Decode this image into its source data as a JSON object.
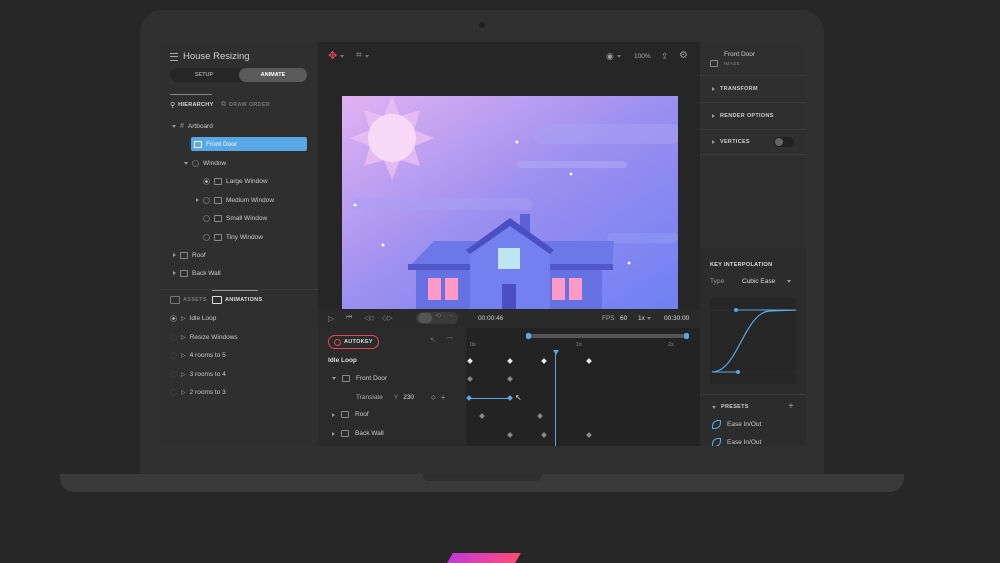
{
  "project": {
    "title": "House Resizing"
  },
  "modes": {
    "setup": "SETUP",
    "animate": "ANIMATE"
  },
  "hierarchy_tabs": {
    "hierarchy": "HIERARCHY",
    "draw_order": "DRAW ORDER"
  },
  "tree": {
    "artboard": "Artboard",
    "front_door": "Front Door",
    "window": "Window",
    "large_window": "Large Window",
    "medium_window": "Medium Window",
    "small_window": "Small Window",
    "tiny_window": "Tiny Window",
    "roof": "Roof",
    "back_wall": "Back Wall"
  },
  "bottom_tabs": {
    "assets": "ASSETS",
    "animations": "ANIMATIONS"
  },
  "animations": [
    "Idle Loop",
    "Resize Windows",
    "4 rooms to 5",
    "3 rooms to 4",
    "2 rooms to 3"
  ],
  "toolbar": {
    "zoom": "100%"
  },
  "playback": {
    "current_time": "00:00:46",
    "fps_label": "FPS",
    "fps": "60",
    "speed": "1x",
    "end_time": "00:30:00"
  },
  "timeline": {
    "autokey": "AUTOKEY",
    "animation_name": "Idle Loop",
    "ticks": [
      "0s",
      "1s",
      "2s"
    ],
    "tracks": {
      "front_door": "Front Door",
      "translate": "Translate",
      "axis": "Y",
      "value": "230",
      "roof": "Roof",
      "back_wall": "Back Wall"
    }
  },
  "inspector": {
    "name": "Front Door",
    "type": "IMAGE",
    "sections": [
      "TRANSFORM",
      "RENDER OPTIONS",
      "VERTICES"
    ],
    "key_interpolation": "KEY INTERPOLATION",
    "type_label": "Type",
    "type_value": "Cubic Ease",
    "presets": "PRESETS",
    "preset_items": [
      "Ease In/Out",
      "Ease In/Out"
    ]
  },
  "colors": {
    "accent": "#58a8e6",
    "autokey": "#e0475a",
    "sky_top": "#d6a7f0",
    "sky_bottom": "#7b7ff0",
    "house": "#6a6ae0"
  }
}
